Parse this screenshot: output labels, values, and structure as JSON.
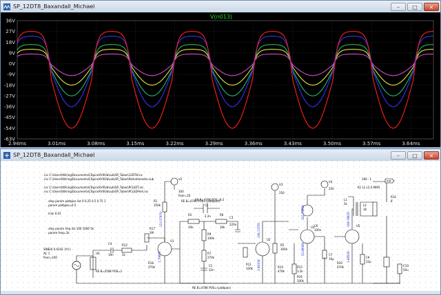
{
  "plot_window": {
    "title": "SP_12DT8_Baxandall_Michael",
    "controls": {
      "minimize": "–",
      "maximize": "□",
      "close": "×"
    },
    "trace_label": "V(n013)",
    "trace_label_color": "#22dd22"
  },
  "chart_data": {
    "type": "line",
    "title": "V(n013)",
    "y_ticks": [
      "36V",
      "27V",
      "18V",
      "9V",
      "0V",
      "-9V",
      "-18V",
      "-27V",
      "-36V",
      "-45V",
      "-54V",
      "-63V"
    ],
    "x_ticks": [
      "2.94ms",
      "3.01ms",
      "3.08ms",
      "3.15ms",
      "3.22ms",
      "3.29ms",
      "3.36ms",
      "3.43ms",
      "3.50ms",
      "3.57ms",
      "3.64ms"
    ],
    "ylim": [
      -63,
      36
    ],
    "xlim": [
      2.94,
      3.68
    ],
    "grid": true,
    "period_ms": 0.143,
    "series": [
      {
        "color": "#ff2020",
        "max": 27,
        "min": -54
      },
      {
        "color": "#3333ff",
        "max": 23,
        "min": -36
      },
      {
        "color": "#1fbf6b",
        "max": 16,
        "min": -27
      },
      {
        "color": "#e6e64a",
        "max": 12,
        "min": -18
      },
      {
        "color": "#d94cc0",
        "max": 8,
        "min": -10
      }
    ]
  },
  "schematic_window": {
    "title": "SP_12DT8_Baxandall_Michael",
    "controls": {
      "minimize": "–",
      "maximize": "□",
      "close": "×"
    },
    "directives": [
      ".inc C:\\Users\\tWiring\\Documents\\LTspiceXVII\\lib\\sub\\SP_Tubes\\12DT8.inc",
      ".inc C:\\Users\\tWiring\\Documents\\LTspiceXVII\\lib\\sub\\SP_Tubes\\Potentiometer.sub",
      ".inc C:\\Users\\tWiring\\Documents\\LTspiceXVII\\lib\\sub\\SP_Tubes\\PCL82T.inc",
      ".inc C:\\Users\\tWiring\\Documents\\LTspiceXVII\\lib\\sub\\SP_Tubes\\PCL82Pent.inc"
    ],
    "step_pot": ".step param potbpos list 0 0.25 0.5 0.75 1",
    "param_pot": ".param potbpos=0.5",
    "tran": ".tran 0.01",
    "step_freq": ".step param freq list 100 1000 5k",
    "param_freq": ".param freq=1k",
    "source": [
      "SINE(0 0.4242 {fr})",
      "AC 1",
      "Rser=100"
    ],
    "labels": {
      "v2": "V2",
      "v2_val": "300",
      "v2_rser": "Rser=10",
      "v3": "V3",
      "v3_val": "250",
      "v4": "V4",
      "v4_val": "250",
      "pot_r8": "R8 R=470K POS=0.3",
      "r1": "R1",
      "r1_val": "150k",
      "r2": "R2",
      "r2_val": "10k",
      "r5": "R5",
      "r5_val": "100k",
      "r6": "R6",
      "r6_val": "10k",
      "c2": "C2",
      "c2_val": "2.2n",
      "c3": "C3",
      "c3_val": "220n",
      "c1": "C1",
      "c1_val": "22n",
      "c4": "C4",
      "c4_val": "10n",
      "r9": "R9",
      "r9_val": "100k",
      "r7": "R7",
      "r7_val": "270k",
      "r11": "R11",
      "r11_val": "100k",
      "r12": "R12",
      "r12_val": "1k",
      "r14": "R14",
      "r14_val": "470k",
      "r15": "R15",
      "r15_val": "1.5k",
      "r17": "R17",
      "r17_val": "1M",
      "r18": "R18",
      "r18_val": "270k",
      "r16": "R16",
      "r16_val": "100k",
      "r20": "R20",
      "r20_val": "470k",
      "pot_bass": "RE B=470K POS={potbpos}",
      "pot_treble": "RE B=470K POS={potbpos}",
      "pot_vol": "RE B=250K POS=1",
      "u1": "U1",
      "u2": "U2",
      "u3": "U3",
      "u4": "U4",
      "u5": "U5",
      "l1": "L1",
      "l2": "L2",
      "k1": "K1 L1 L2 0.9995",
      "l1_val": "5k",
      "l2_val": "16",
      "rl": "R10",
      "rl_val": "8",
      "c6": "C6",
      "c6_val": "100n",
      "c7": "C7",
      "c7_val": "10µ",
      "c9": "C9",
      "c9_val": "22µ",
      "c10": "C10",
      "c10_val": "50u",
      "out": "out",
      "ratio": "166 : 1",
      "tube_a": "110.3797V",
      "tube_b": "146.1375V",
      "tube_c": "162.7466V",
      "tube_d": "168.7862V",
      "tube_e": "1.7986V",
      "tube_f": "3.8910V",
      "tube_g": "53.8908V",
      "tube_h": "1.6853V"
    }
  }
}
